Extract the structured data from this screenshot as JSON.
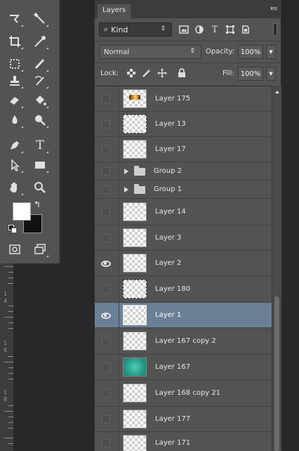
{
  "toolbox": {
    "tools": [
      {
        "icon": "lasso-icon"
      },
      {
        "icon": "magic-wand-icon"
      },
      {
        "icon": "crop-icon"
      },
      {
        "icon": "eyedropper-icon"
      },
      {
        "icon": "healing-brush-icon"
      },
      {
        "icon": "brush-icon"
      },
      {
        "icon": "clone-stamp-icon"
      },
      {
        "icon": "history-brush-icon"
      },
      {
        "icon": "eraser-icon"
      },
      {
        "icon": "paint-bucket-icon"
      },
      {
        "icon": "blur-icon"
      },
      {
        "icon": "dodge-icon"
      },
      {
        "icon": "pen-icon"
      },
      {
        "icon": "type-icon"
      },
      {
        "icon": "path-selection-icon"
      },
      {
        "icon": "rectangle-shape-icon"
      },
      {
        "icon": "hand-icon"
      },
      {
        "icon": "zoom-icon"
      },
      {
        "icon": "quick-mask-icon"
      },
      {
        "icon": "screen-mode-icon"
      }
    ],
    "type_tool_glyph": "T",
    "swap_glyph": "↰",
    "foreground_color": "#ffffff",
    "background_color": "#111111"
  },
  "ruler": {
    "labels": [
      "1",
      "4",
      "1",
      "6",
      "1",
      "8"
    ]
  },
  "layers_panel": {
    "tab_label": "Layers",
    "menu_glyph": "▾≡",
    "filter": {
      "kind_label": "Kind",
      "search_glyph": "⌕",
      "updown_glyph": "⇕",
      "icons": [
        "image-filter-icon",
        "adjustment-filter-icon",
        "type-filter-icon",
        "shape-filter-icon",
        "smart-object-filter-icon"
      ]
    },
    "blend_mode": "Normal",
    "opacity_label": "Opacity:",
    "opacity_value": "100%",
    "lock_label": "Lock:",
    "fill_label": "Fill:",
    "fill_value": "100%",
    "layers": [
      {
        "name": "Layer 175",
        "type": "layer",
        "visible": false,
        "selected": false,
        "thumb": "orange-mark"
      },
      {
        "name": "Layer 13",
        "type": "layer",
        "visible": false,
        "selected": false,
        "thumb": "dashed"
      },
      {
        "name": "Layer 17",
        "type": "layer",
        "visible": false,
        "selected": false,
        "thumb": "checker"
      },
      {
        "name": "Group 2",
        "type": "group",
        "visible": false,
        "selected": false
      },
      {
        "name": "Group 1",
        "type": "group",
        "visible": false,
        "selected": false
      },
      {
        "name": "Layer 14",
        "type": "layer",
        "visible": false,
        "selected": false,
        "thumb": "checker"
      },
      {
        "name": "Layer 3",
        "type": "layer",
        "visible": false,
        "selected": false,
        "thumb": "checker"
      },
      {
        "name": "Layer 2",
        "type": "layer",
        "visible": true,
        "selected": false,
        "thumb": "checker"
      },
      {
        "name": "Layer 180",
        "type": "layer",
        "visible": false,
        "selected": false,
        "thumb": "dashed"
      },
      {
        "name": "Layer 1",
        "type": "layer",
        "visible": true,
        "selected": true,
        "thumb": "selected-frame"
      },
      {
        "name": "Layer 167 copy 2",
        "type": "layer",
        "visible": false,
        "selected": false,
        "thumb": "checker"
      },
      {
        "name": "Layer 167",
        "type": "layer",
        "visible": false,
        "selected": false,
        "thumb": "teal"
      },
      {
        "name": "Layer 168 copy 21",
        "type": "layer",
        "visible": false,
        "selected": false,
        "thumb": "checker"
      },
      {
        "name": "Layer 177",
        "type": "layer",
        "visible": false,
        "selected": false,
        "thumb": "checker"
      },
      {
        "name": "Layer 171",
        "type": "layer",
        "visible": false,
        "selected": false,
        "thumb": "checker"
      }
    ]
  },
  "colors": {
    "panel_bg": "#535353",
    "selected_row": "#6b7f96",
    "workspace_bg": "#282828"
  }
}
